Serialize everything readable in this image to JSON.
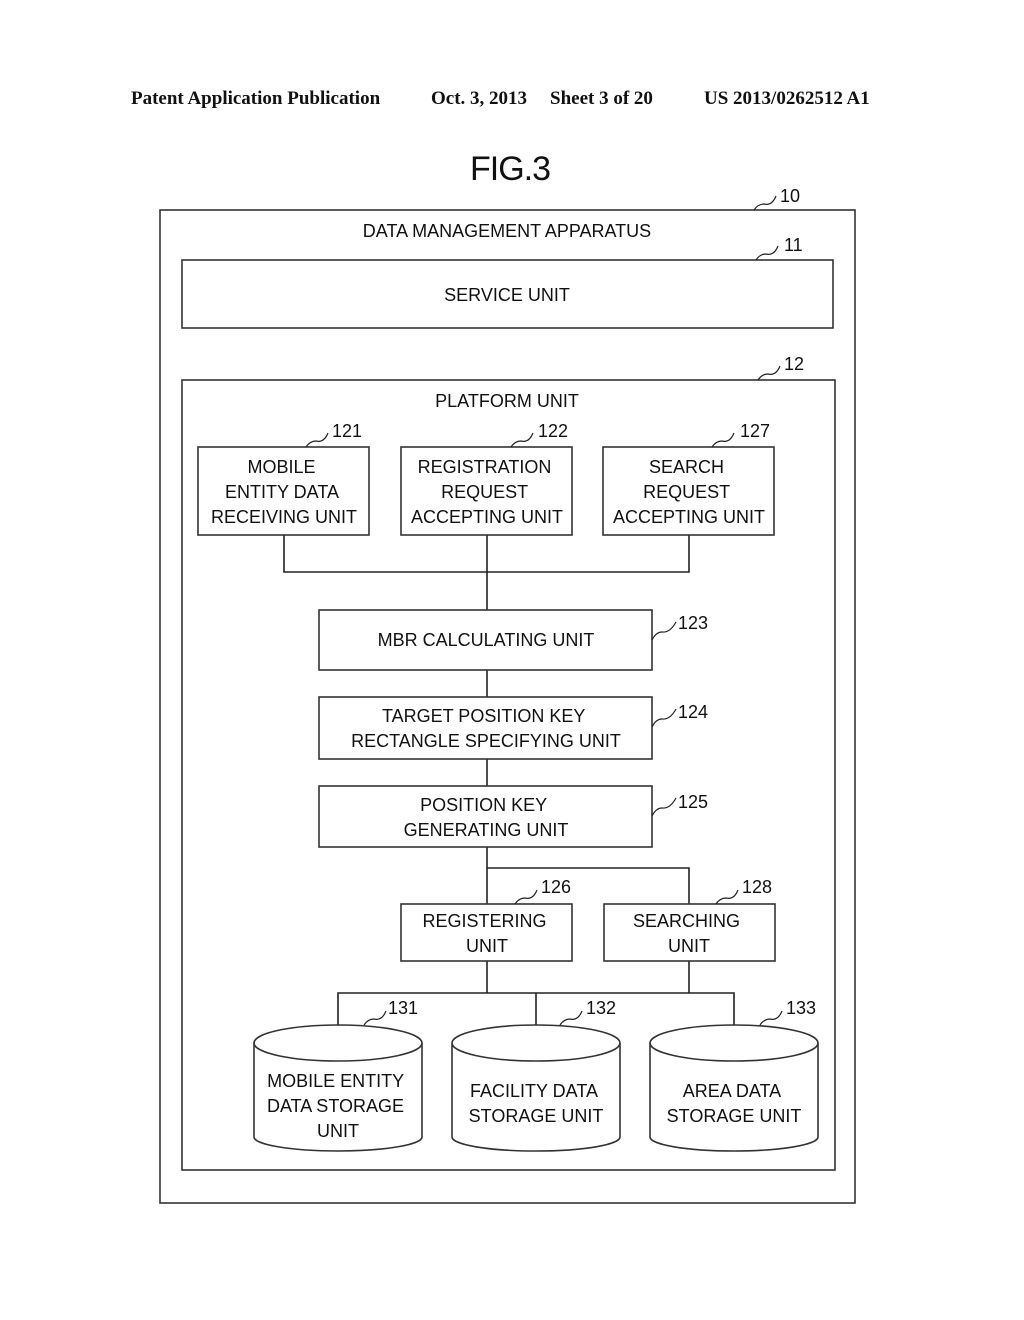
{
  "header": {
    "publication": "Patent Application Publication",
    "date": "Oct. 3, 2013",
    "sheet": "Sheet 3 of 20",
    "number": "US 2013/0262512 A1"
  },
  "figure": {
    "title": "FIG.3",
    "apparatus": {
      "ref": "10",
      "label": "DATA MANAGEMENT APPARATUS"
    },
    "service_unit": {
      "ref": "11",
      "label": "SERVICE UNIT"
    },
    "platform_unit": {
      "ref": "12",
      "label": "PLATFORM UNIT"
    },
    "units": {
      "mobile_receiving": {
        "ref": "121",
        "lines": [
          "MOBILE",
          "ENTITY DATA",
          "RECEIVING UNIT"
        ]
      },
      "registration_request": {
        "ref": "122",
        "lines": [
          "REGISTRATION",
          "REQUEST",
          "ACCEPTING UNIT"
        ]
      },
      "search_request": {
        "ref": "127",
        "lines": [
          "SEARCH",
          "REQUEST",
          "ACCEPTING UNIT"
        ]
      },
      "mbr": {
        "ref": "123",
        "lines": [
          "MBR CALCULATING UNIT"
        ]
      },
      "target_key": {
        "ref": "124",
        "lines": [
          "TARGET POSITION KEY",
          "RECTANGLE SPECIFYING UNIT"
        ]
      },
      "key_gen": {
        "ref": "125",
        "lines": [
          "POSITION KEY",
          "GENERATING UNIT"
        ]
      },
      "registering": {
        "ref": "126",
        "lines": [
          "REGISTERING",
          "UNIT"
        ]
      },
      "searching": {
        "ref": "128",
        "lines": [
          "SEARCHING",
          "UNIT"
        ]
      }
    },
    "storages": {
      "mobile_storage": {
        "ref": "131",
        "lines": [
          "MOBILE ENTITY",
          "DATA STORAGE",
          "UNIT"
        ]
      },
      "facility_storage": {
        "ref": "132",
        "lines": [
          "FACILITY DATA",
          "STORAGE UNIT"
        ]
      },
      "area_storage": {
        "ref": "133",
        "lines": [
          "AREA DATA",
          "STORAGE UNIT"
        ]
      }
    }
  }
}
